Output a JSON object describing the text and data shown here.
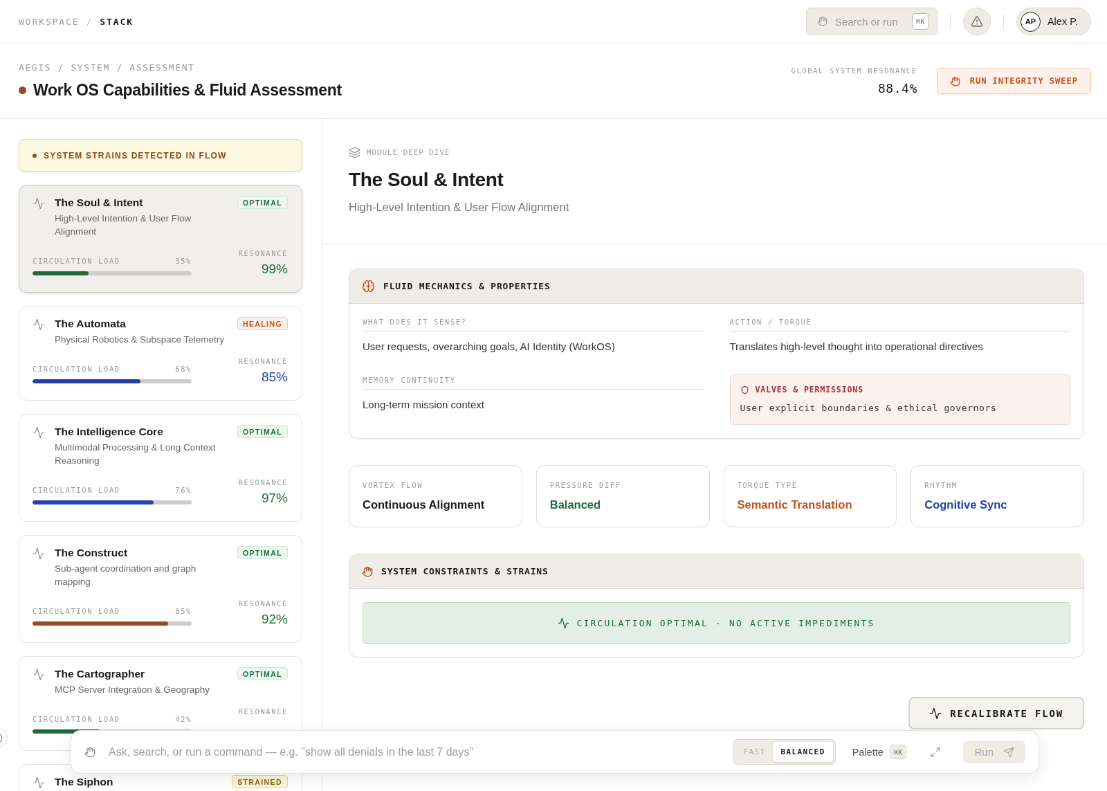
{
  "top_bar": {
    "breadcrumb": {
      "separator": "/",
      "items": [
        {
          "label": "WORKSPACE",
          "current": false
        },
        {
          "label": "STACK",
          "current": true
        }
      ]
    },
    "search": {
      "placeholder": "Search or run",
      "shortcut": "⌘K"
    },
    "user": {
      "initials": "AP",
      "name": "Alex P."
    }
  },
  "header": {
    "path": "AEGIS / SYSTEM / ASSESSMENT",
    "title": "Work OS Capabilities & Fluid Assessment",
    "resonance": {
      "label": "GLOBAL SYSTEM RESONANCE",
      "reading": "88.4%"
    },
    "sweep_button": "RUN INTEGRITY SWEEP"
  },
  "sidebar": {
    "alert": "SYSTEM STRAINS DETECTED IN FLOW",
    "modules": [
      {
        "name": "The Soul & Intent",
        "description": "High-Level Intention & User Flow Alignment",
        "selected": true,
        "status": {
          "label": "OPTIMAL",
          "kind": "optimal"
        },
        "load": {
          "label": "CIRCULATION LOAD",
          "reading": "35%",
          "level": 0.35,
          "color": "#1e6b3a"
        },
        "resonance": {
          "label": "RESONANCE",
          "reading": "99%",
          "color": "#1e6b3a"
        }
      },
      {
        "name": "The Automata",
        "description": "Physical Robotics & Subspace Telemetry",
        "selected": false,
        "status": {
          "label": "HEALING",
          "kind": "healing"
        },
        "load": {
          "label": "CIRCULATION LOAD",
          "reading": "68%",
          "level": 0.68,
          "color": "#2540a8"
        },
        "resonance": {
          "label": "RESONANCE",
          "reading": "85%",
          "color": "#2540a8"
        }
      },
      {
        "name": "The Intelligence Core",
        "description": "Multimodal Processing & Long Context Reasoning",
        "selected": false,
        "status": {
          "label": "OPTIMAL",
          "kind": "optimal"
        },
        "load": {
          "label": "CIRCULATION LOAD",
          "reading": "76%",
          "level": 0.76,
          "color": "#2540a8"
        },
        "resonance": {
          "label": "RESONANCE",
          "reading": "97%",
          "color": "#1e6b3a"
        }
      },
      {
        "name": "The Construct",
        "description": "Sub-agent coordination and graph mapping",
        "selected": false,
        "status": {
          "label": "OPTIMAL",
          "kind": "optimal"
        },
        "load": {
          "label": "CIRCULATION LOAD",
          "reading": "85%",
          "level": 0.85,
          "color": "#9a4a1f"
        },
        "resonance": {
          "label": "RESONANCE",
          "reading": "92%",
          "color": "#1e6b3a"
        }
      },
      {
        "name": "The Cartographer",
        "description": "MCP Server Integration & Geography",
        "selected": false,
        "status": {
          "label": "OPTIMAL",
          "kind": "optimal"
        },
        "load": {
          "label": "CIRCULATION LOAD",
          "reading": "42%",
          "level": 0.42,
          "color": "#1e6b3a"
        },
        "resonance": {
          "label": "RESONANCE"
        }
      },
      {
        "name": "The Siphon",
        "selected": false,
        "status": {
          "label": "STRAINED",
          "kind": "strained"
        }
      }
    ]
  },
  "detail": {
    "eyebrow": "MODULE DEEP DIVE",
    "title": "The Soul & Intent",
    "subtitle": "High-Level Intention & User Flow Alignment",
    "properties": {
      "title": "FLUID MECHANICS & PROPERTIES",
      "items": [
        {
          "kind": "field",
          "label": "WHAT DOES IT SENSE?",
          "value": "User requests, overarching goals, AI Identity (WorkOS)"
        },
        {
          "kind": "field",
          "label": "ACTION / TORQUE",
          "value": "Translates high-level thought into operational directives"
        },
        {
          "kind": "field",
          "label": "MEMORY CONTINUITY",
          "value": "Long-term mission context"
        },
        {
          "kind": "notice",
          "label": "VALVES & PERMISSIONS",
          "value": "User explicit boundaries & ethical governors"
        }
      ]
    },
    "metrics": [
      {
        "label": "VORTEX FLOW",
        "value": "Continuous Alignment",
        "color": "#1a1a1a"
      },
      {
        "label": "PRESSURE DIFF",
        "value": "Balanced",
        "color": "#1e6b3a"
      },
      {
        "label": "TORQUE TYPE",
        "value": "Semantic Translation",
        "color": "#c2521c"
      },
      {
        "label": "RHYTHM",
        "value": "Cognitive Sync",
        "color": "#2540a8"
      }
    ],
    "constraints": {
      "title": "SYSTEM CONSTRAINTS & STRAINS",
      "status": {
        "kind": "clear",
        "text": "CIRCULATION OPTIMAL - NO ACTIVE IMPEDIMENTS"
      }
    },
    "recalibrate_button": "RECALIBRATE FLOW"
  },
  "command_bar": {
    "placeholder": "Ask, search, or run a command — e.g. \"show all denials in the last 7 days\"",
    "modes": [
      {
        "label": "FAST",
        "selected": false
      },
      {
        "label": "BALANCED",
        "selected": true
      }
    ],
    "palette": {
      "label": "Palette",
      "shortcut": "⌘K"
    },
    "run_button": {
      "label": "Run",
      "disabled": true
    }
  }
}
